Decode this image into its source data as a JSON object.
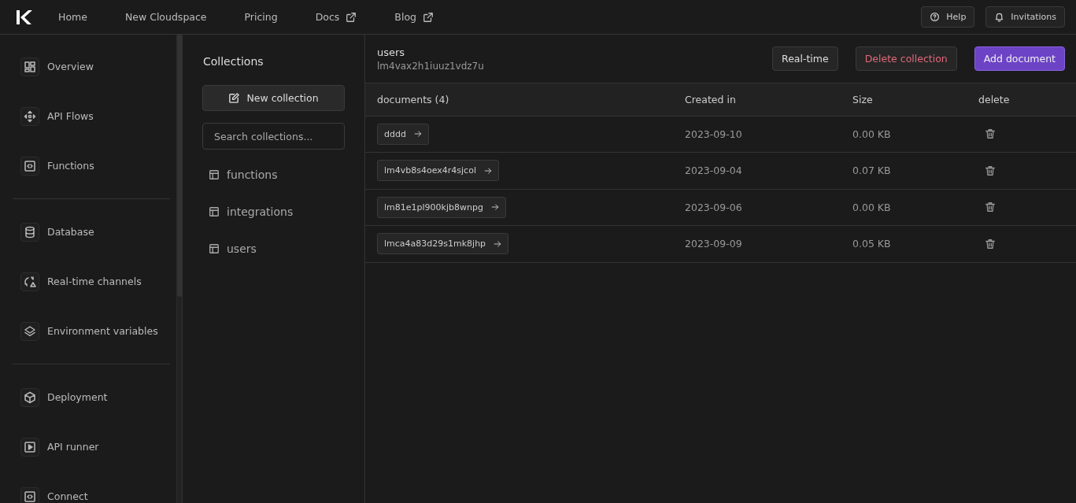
{
  "nav": {
    "links": [
      {
        "label": "Home",
        "external": false
      },
      {
        "label": "New Cloudspace",
        "external": false
      },
      {
        "label": "Pricing",
        "external": false
      },
      {
        "label": "Docs",
        "external": true
      },
      {
        "label": "Blog",
        "external": true
      }
    ],
    "buttons": [
      {
        "kind": "help",
        "label": "Help"
      },
      {
        "kind": "bell",
        "label": "Invitations"
      }
    ]
  },
  "sidebar": {
    "groups": [
      [
        {
          "label": "Overview"
        },
        {
          "label": "API Flows"
        },
        {
          "label": "Functions"
        }
      ],
      [
        {
          "label": "Database"
        },
        {
          "label": "Real-time channels"
        },
        {
          "label": "Environment variables"
        }
      ],
      [
        {
          "label": "Deployment"
        },
        {
          "label": "API runner"
        },
        {
          "label": "Connect"
        }
      ]
    ]
  },
  "collections": {
    "title": "Collections",
    "new_button": "New collection",
    "search": {
      "placeholder": "Search collections..."
    },
    "items": [
      {
        "label": "functions"
      },
      {
        "label": "integrations"
      },
      {
        "label": "users"
      }
    ]
  },
  "main": {
    "title": "users",
    "id": "lm4vax2h1iuuz1vdz7u",
    "buttons": [
      {
        "kind": "plain",
        "label": "Real-time"
      },
      {
        "kind": "danger",
        "label": "Delete collection"
      },
      {
        "kind": "primary",
        "label": "Add document"
      }
    ],
    "table": {
      "columns": [
        "documents (4)",
        "Created in",
        "Size",
        "delete"
      ],
      "rows": [
        {
          "document": "dddd",
          "created": "2023-09-10",
          "size": "0.00 KB"
        },
        {
          "document": "lm4vb8s4oex4r4sjcol",
          "created": "2023-09-04",
          "size": "0.07 KB"
        },
        {
          "document": "lm81e1pl900kjb8wnpg",
          "created": "2023-09-06",
          "size": "0.00 KB"
        },
        {
          "document": "lmca4a83d29s1mk8jhp",
          "created": "2023-09-09",
          "size": "0.05 KB"
        }
      ]
    }
  }
}
